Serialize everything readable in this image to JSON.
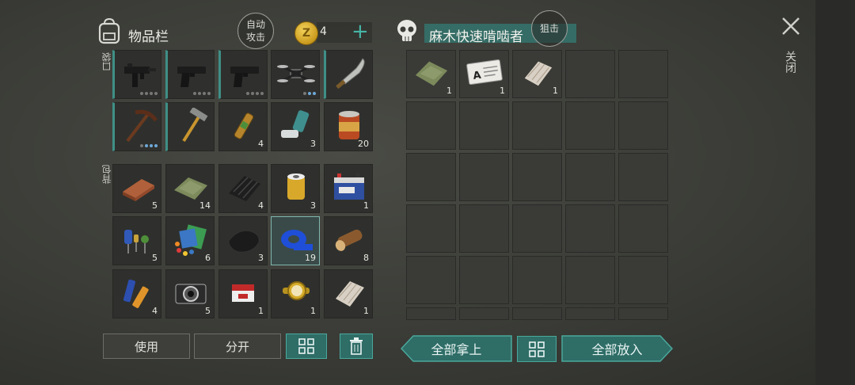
{
  "inventory": {
    "title": "物品栏",
    "auto_attack_line1": "自动",
    "auto_attack_line2": "攻击",
    "coin_symbol": "Z",
    "coin_count": "4",
    "coin_add": "+",
    "pocket_label": "口袋",
    "backpack_label": "背包"
  },
  "pocket_slots": [
    {
      "icon": "uzi-icon"
    },
    {
      "icon": "pistol-icon"
    },
    {
      "icon": "pistol-icon"
    },
    {
      "icon": "drone-icon"
    },
    {
      "icon": "machete-icon"
    },
    {
      "icon": "pickaxe-icon"
    },
    {
      "icon": "hammer-icon"
    },
    {
      "icon": "stimulant-icon",
      "count": "4"
    },
    {
      "icon": "inhaler-icon",
      "count": "3"
    },
    {
      "icon": "canned-food-icon",
      "count": "20"
    }
  ],
  "backpack_slots": [
    {
      "icon": "copper-bar-icon",
      "count": "5"
    },
    {
      "icon": "cloth-icon",
      "count": "14"
    },
    {
      "icon": "rubber-icon",
      "count": "4"
    },
    {
      "icon": "oil-filter-icon",
      "count": "3"
    },
    {
      "icon": "battery-icon",
      "count": "1"
    },
    {
      "icon": "electronic-parts-icon",
      "count": "5"
    },
    {
      "icon": "plastic-sheets-icon",
      "count": "6"
    },
    {
      "icon": "leather-icon",
      "count": "3"
    },
    {
      "icon": "duct-tape-icon",
      "count": "19"
    },
    {
      "icon": "log-icon",
      "count": "8"
    },
    {
      "icon": "aa-batteries-icon",
      "count": "4"
    },
    {
      "icon": "camera-icon",
      "count": "5"
    },
    {
      "icon": "cigarettes-icon",
      "count": "1"
    },
    {
      "icon": "gold-watch-icon",
      "count": "1"
    },
    {
      "icon": "rope-icon",
      "count": "1"
    }
  ],
  "loot": {
    "name": "麻木快速啃啮者",
    "tag": "狙击",
    "close_label": "关闭",
    "items": [
      {
        "icon": "cloth-icon",
        "count": "1"
      },
      {
        "icon": "id-card-icon",
        "count": "1",
        "card_text": "A"
      },
      {
        "icon": "rope-icon",
        "count": "1"
      }
    ]
  },
  "buttons": {
    "use": "使用",
    "split": "分开",
    "take_all": "全部拿上",
    "put_all": "全部放入"
  },
  "colors": {
    "accent": "#2f6d67",
    "accent_border": "#4aa89c",
    "durability": "#3f8f86"
  }
}
